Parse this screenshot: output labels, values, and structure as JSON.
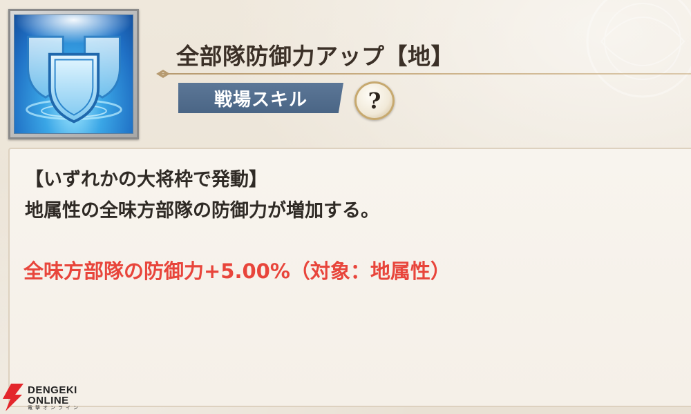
{
  "skill": {
    "icon": "shield-defense-icon",
    "title": "全部隊防御力アップ【地】",
    "category_badge": "戦場スキル",
    "help_button": "?"
  },
  "description": {
    "lines": [
      "【いずれかの大将枠で発動】",
      "地属性の全味方部隊の防御力が増加する。"
    ],
    "effect": "全味方部隊の防御力+5.00%（対象：地属性）"
  },
  "watermark": {
    "line1": "DENGEKI",
    "line2": "ONLINE",
    "sub": "電撃オンライン",
    "icon": "dengeki-bolt-logo"
  },
  "colors": {
    "badge_bg": "#4f6a8a",
    "effect_text": "#e8453b",
    "title_text": "#3b3027"
  }
}
